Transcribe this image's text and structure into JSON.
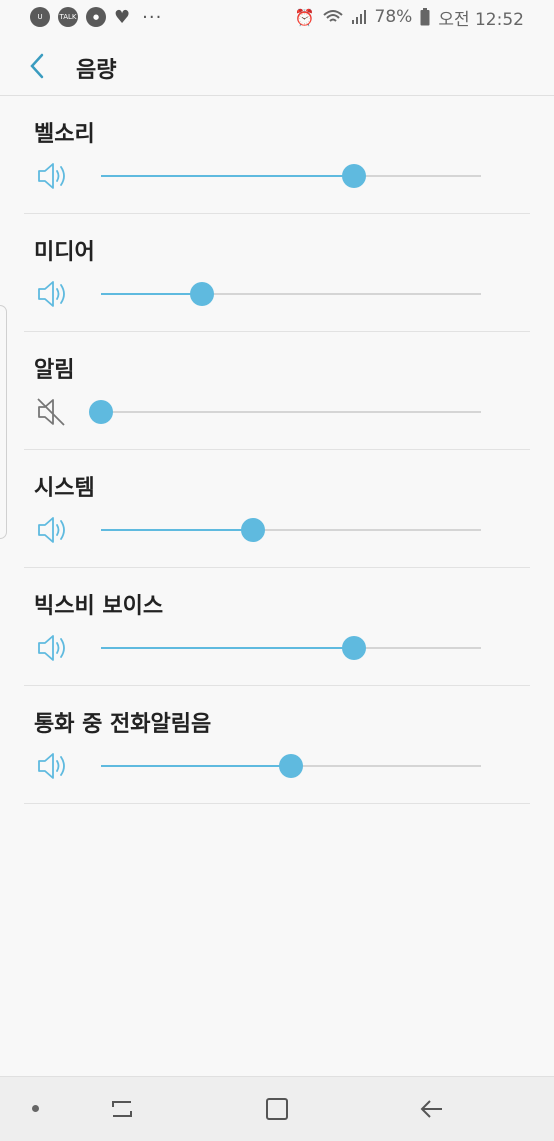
{
  "status": {
    "talk_badge": "TALK",
    "battery": "78%",
    "time": "오전 12:52",
    "more": "···"
  },
  "header": {
    "title": "음량"
  },
  "rows": [
    {
      "label": "벨소리",
      "level": 0.665,
      "muted": false
    },
    {
      "label": "미디어",
      "level": 0.265,
      "muted": false
    },
    {
      "label": "알림",
      "level": 0.0,
      "muted": true
    },
    {
      "label": "시스템",
      "level": 0.4,
      "muted": false
    },
    {
      "label": "빅스비 보이스",
      "level": 0.665,
      "muted": false
    },
    {
      "label": "통화 중 전화알림음",
      "level": 0.5,
      "muted": false
    }
  ],
  "colors": {
    "accent": "#5fbadf",
    "track": "#d5d5d5",
    "muted_icon": "#777777"
  }
}
